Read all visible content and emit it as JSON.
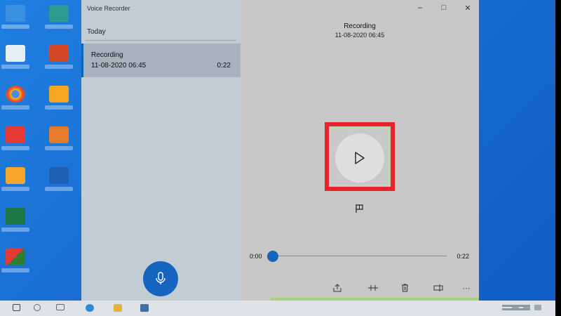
{
  "app": {
    "title": "Voice Recorder"
  },
  "recordings_list": {
    "group_header": "Today",
    "items": [
      {
        "name": "Recording",
        "date": "11-08-2020 06:45",
        "duration": "0:22"
      }
    ]
  },
  "player": {
    "title": "Recording",
    "date": "11-08-2020 06:45",
    "time_current": "0:00",
    "time_total": "0:22",
    "progress": 0
  },
  "icons": {
    "play": "play-icon",
    "mic": "microphone-icon",
    "flag": "flag-icon",
    "share": "share-icon",
    "trim": "trim-icon",
    "delete": "trash-icon",
    "rename": "rename-icon",
    "more": "more-icon",
    "minimize": "minimize-icon",
    "maximize": "maximize-icon",
    "close": "close-icon"
  },
  "colors": {
    "accent": "#1565c0",
    "highlight_border": "#e8242d",
    "desktop": "#1a6fd4"
  }
}
